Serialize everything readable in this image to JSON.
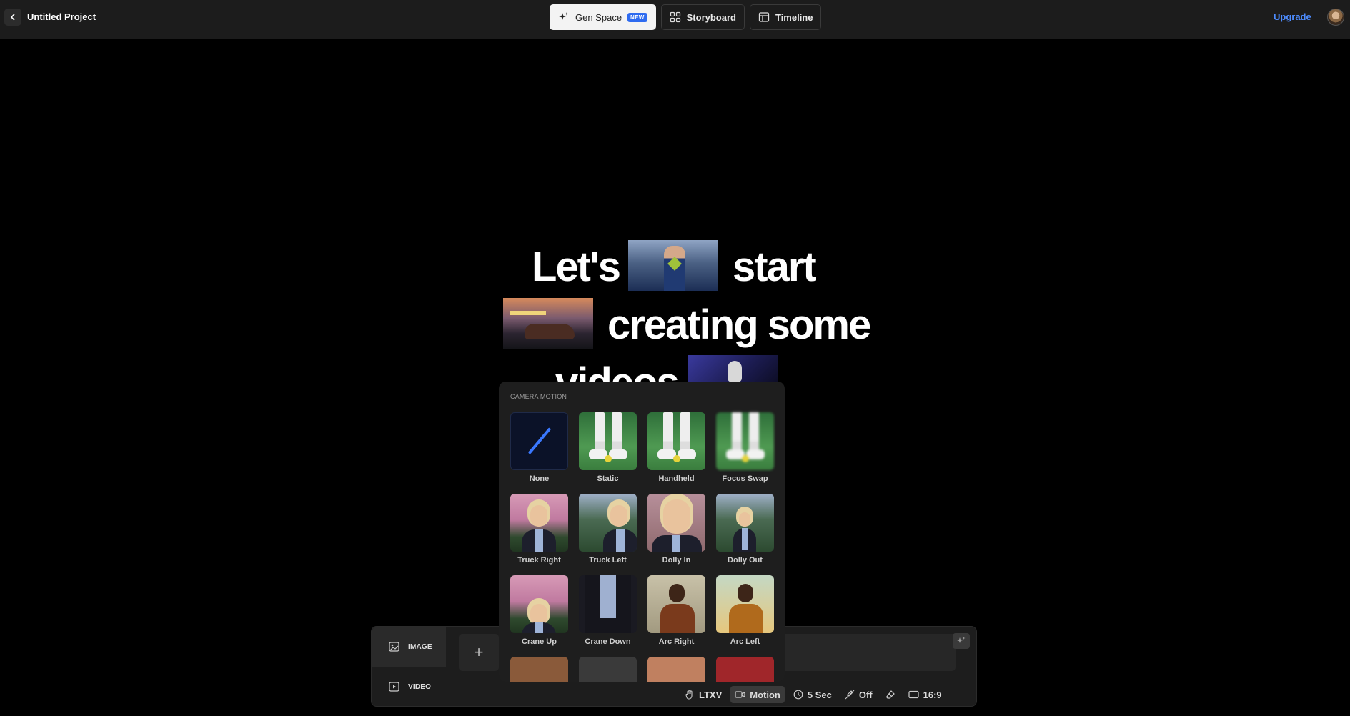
{
  "header": {
    "project_title": "Untitled Project",
    "tabs": [
      {
        "label": "Gen Space",
        "badge": "NEW",
        "active": true
      },
      {
        "label": "Storyboard",
        "active": false
      },
      {
        "label": "Timeline",
        "active": false
      }
    ],
    "upgrade_label": "Upgrade"
  },
  "hero": {
    "line1_a": "Let's",
    "line1_b": "start",
    "line2": "creating some",
    "line3": "videos"
  },
  "prompt_panel": {
    "modes": [
      {
        "label": "IMAGE",
        "icon": "image-icon",
        "active": true
      },
      {
        "label": "VIDEO",
        "icon": "video-icon",
        "active": false
      }
    ],
    "add_label": "+",
    "options": {
      "model": "LTXV",
      "motion": "Motion",
      "duration": "5 Sec",
      "audio": "Off",
      "aspect": "16:9"
    }
  },
  "camera_motion": {
    "title": "CAMERA MOTION",
    "items": [
      {
        "label": "None"
      },
      {
        "label": "Static"
      },
      {
        "label": "Handheld"
      },
      {
        "label": "Focus Swap"
      },
      {
        "label": "Truck Right"
      },
      {
        "label": "Truck Left"
      },
      {
        "label": "Dolly In"
      },
      {
        "label": "Dolly Out"
      },
      {
        "label": "Crane Up"
      },
      {
        "label": "Crane Down"
      },
      {
        "label": "Arc Right"
      },
      {
        "label": "Arc Left"
      }
    ]
  },
  "colors": {
    "accent": "#4d8cff",
    "badge": "#2e6bf0",
    "topbar_bg": "#1c1c1c",
    "panel_bg": "#1d1d1d"
  }
}
